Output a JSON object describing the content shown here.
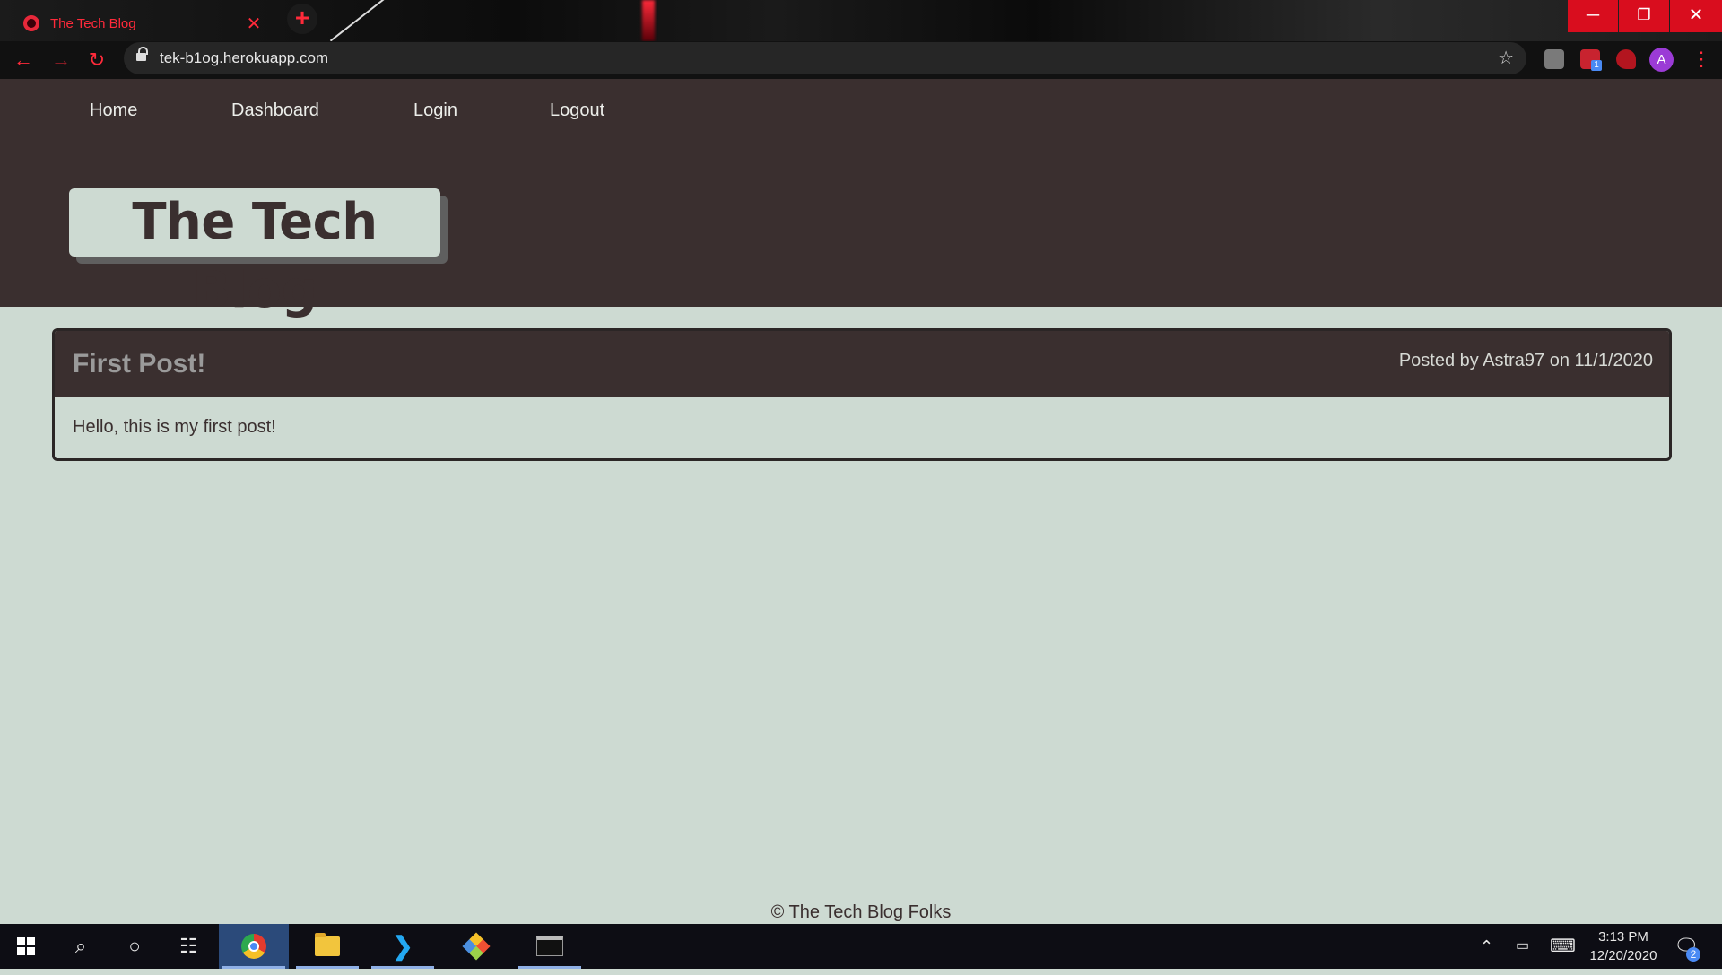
{
  "browser": {
    "tab": {
      "title": "The Tech Blog",
      "close_symbol": "✕"
    },
    "new_tab_symbol": "+",
    "window_controls": {
      "minimize": "─",
      "restore": "❐",
      "close": "✕"
    },
    "nav_buttons": {
      "back": "←",
      "forward": "→",
      "reload": "↻"
    },
    "address_bar": {
      "url": "tek-b1og.herokuapp.com"
    },
    "bookmark_symbol": "☆",
    "profile_initial": "A",
    "extension_badge": "1",
    "menu_symbol": "⋮"
  },
  "site": {
    "nav": [
      {
        "label": "Home"
      },
      {
        "label": "Dashboard"
      },
      {
        "label": "Login"
      },
      {
        "label": "Logout"
      }
    ],
    "logo_text": "The Tech Blog",
    "posts": [
      {
        "title": "First Post!",
        "meta": "Posted by Astra97 on 11/1/2020",
        "body": "Hello, this is my first post!"
      }
    ],
    "footer": "© The Tech Blog Folks"
  },
  "taskbar": {
    "apps": [
      "start",
      "search",
      "cortana",
      "task-view",
      "chrome",
      "file-explorer",
      "vscode",
      "git",
      "terminal"
    ],
    "clock": {
      "time": "3:13 PM",
      "date": "12/20/2020"
    },
    "notification_count": "2"
  },
  "colors": {
    "header_bg": "#3a2f2f",
    "page_bg": "#cddad2",
    "accent_red": "#ff2a3a",
    "window_close_red": "#d90d1e"
  }
}
